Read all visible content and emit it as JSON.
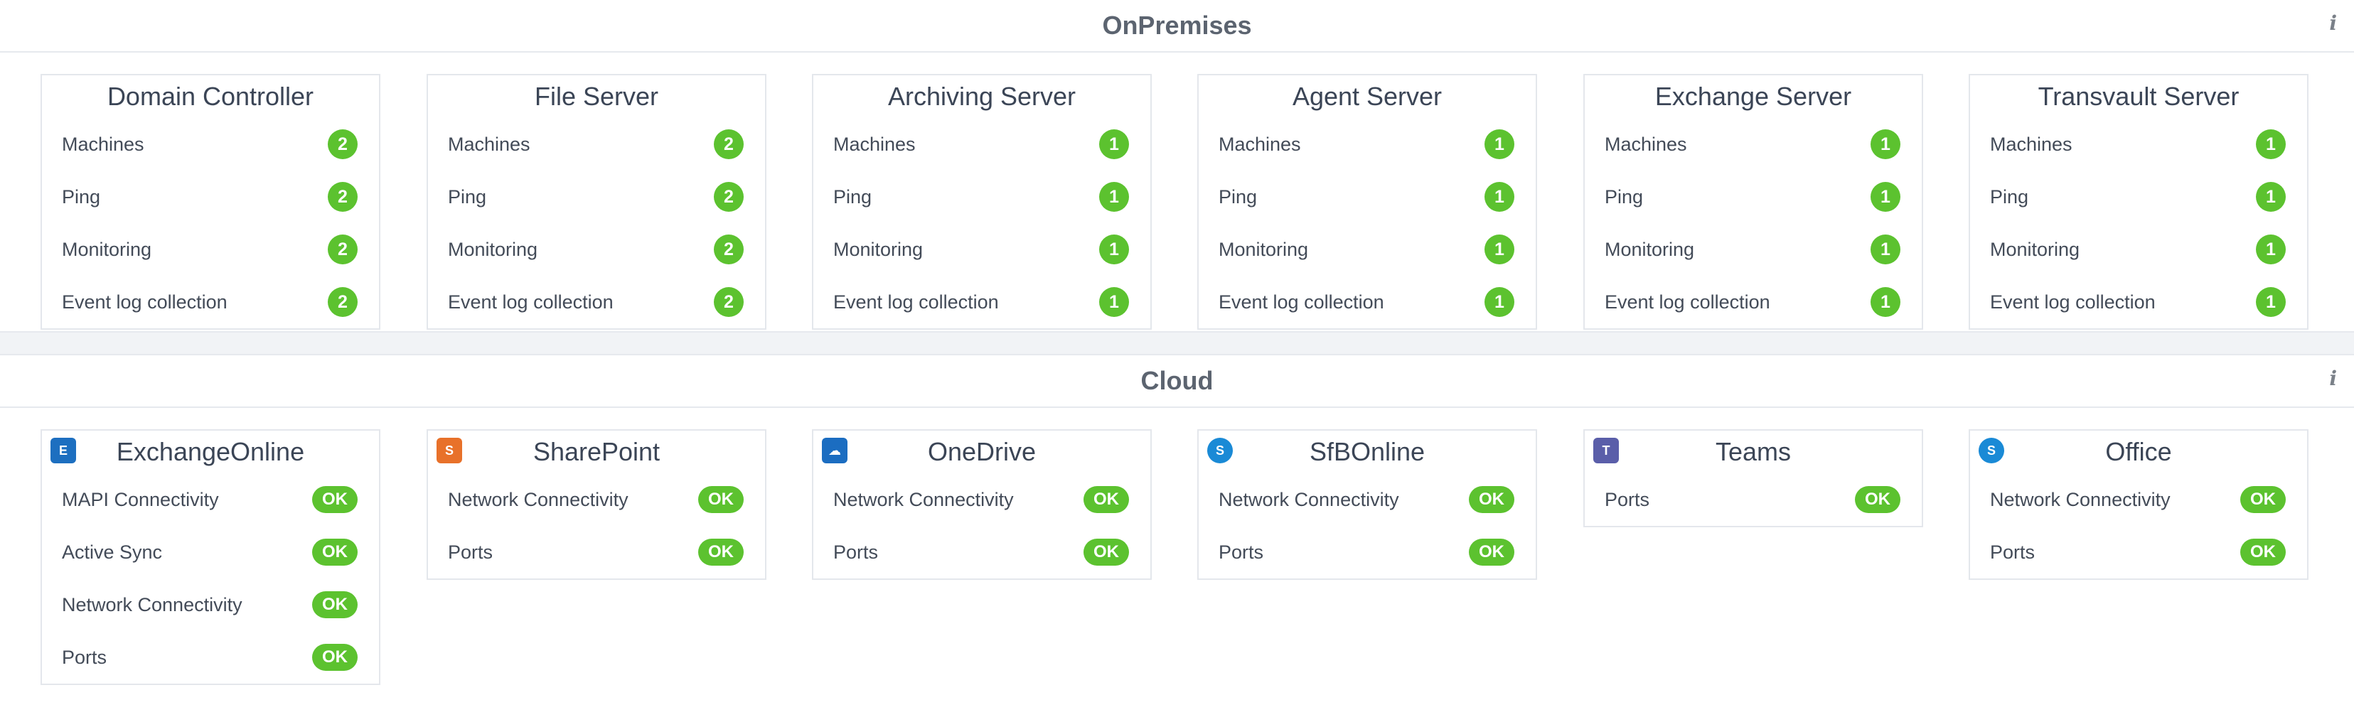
{
  "onprem": {
    "title": "OnPremises",
    "info": "i",
    "cards": [
      {
        "title": "Domain Controller",
        "rows": [
          {
            "label": "Machines",
            "value": "2"
          },
          {
            "label": "Ping",
            "value": "2"
          },
          {
            "label": "Monitoring",
            "value": "2"
          },
          {
            "label": "Event log collection",
            "value": "2"
          }
        ]
      },
      {
        "title": "File Server",
        "rows": [
          {
            "label": "Machines",
            "value": "2"
          },
          {
            "label": "Ping",
            "value": "2"
          },
          {
            "label": "Monitoring",
            "value": "2"
          },
          {
            "label": "Event log collection",
            "value": "2"
          }
        ]
      },
      {
        "title": "Archiving Server",
        "rows": [
          {
            "label": "Machines",
            "value": "1"
          },
          {
            "label": "Ping",
            "value": "1"
          },
          {
            "label": "Monitoring",
            "value": "1"
          },
          {
            "label": "Event log collection",
            "value": "1"
          }
        ]
      },
      {
        "title": "Agent Server",
        "rows": [
          {
            "label": "Machines",
            "value": "1"
          },
          {
            "label": "Ping",
            "value": "1"
          },
          {
            "label": "Monitoring",
            "value": "1"
          },
          {
            "label": "Event log collection",
            "value": "1"
          }
        ]
      },
      {
        "title": "Exchange Server",
        "rows": [
          {
            "label": "Machines",
            "value": "1"
          },
          {
            "label": "Ping",
            "value": "1"
          },
          {
            "label": "Monitoring",
            "value": "1"
          },
          {
            "label": "Event log collection",
            "value": "1"
          }
        ]
      },
      {
        "title": "Transvault Server",
        "rows": [
          {
            "label": "Machines",
            "value": "1"
          },
          {
            "label": "Ping",
            "value": "1"
          },
          {
            "label": "Monitoring",
            "value": "1"
          },
          {
            "label": "Event log collection",
            "value": "1"
          }
        ]
      }
    ]
  },
  "cloud": {
    "title": "Cloud",
    "info": "i",
    "cards": [
      {
        "title": "ExchangeOnline",
        "icon": "exchange-online-icon",
        "icon_color": "#1d6fc0",
        "icon_glyph": "E",
        "rows": [
          {
            "label": "MAPI Connectivity",
            "value": "OK"
          },
          {
            "label": "Active Sync",
            "value": "OK"
          },
          {
            "label": "Network Connectivity",
            "value": "OK"
          },
          {
            "label": "Ports",
            "value": "OK"
          }
        ]
      },
      {
        "title": "SharePoint",
        "icon": "sharepoint-icon",
        "icon_color": "#e8712a",
        "icon_glyph": "S",
        "rows": [
          {
            "label": "Network Connectivity",
            "value": "OK"
          },
          {
            "label": "Ports",
            "value": "OK"
          }
        ]
      },
      {
        "title": "OneDrive",
        "icon": "onedrive-cloud-icon",
        "icon_color": "#1b6dc1",
        "icon_glyph": "☁",
        "rows": [
          {
            "label": "Network Connectivity",
            "value": "OK"
          },
          {
            "label": "Ports",
            "value": "OK"
          }
        ]
      },
      {
        "title": "SfBOnline",
        "icon": "skype-icon",
        "icon_color": "#1a8ad6",
        "icon_glyph": "S",
        "rows": [
          {
            "label": "Network Connectivity",
            "value": "OK"
          },
          {
            "label": "Ports",
            "value": "OK"
          }
        ]
      },
      {
        "title": "Teams",
        "icon": "teams-icon",
        "icon_color": "#5a5ea9",
        "icon_glyph": "T",
        "rows": [
          {
            "label": "Ports",
            "value": "OK"
          }
        ]
      },
      {
        "title": "Office",
        "icon": "skype-icon",
        "icon_color": "#1a8ad6",
        "icon_glyph": "S",
        "rows": [
          {
            "label": "Network Connectivity",
            "value": "OK"
          },
          {
            "label": "Ports",
            "value": "OK"
          }
        ]
      }
    ]
  },
  "colors": {
    "ok": "#5cc22f",
    "border": "#e4e7ec"
  }
}
